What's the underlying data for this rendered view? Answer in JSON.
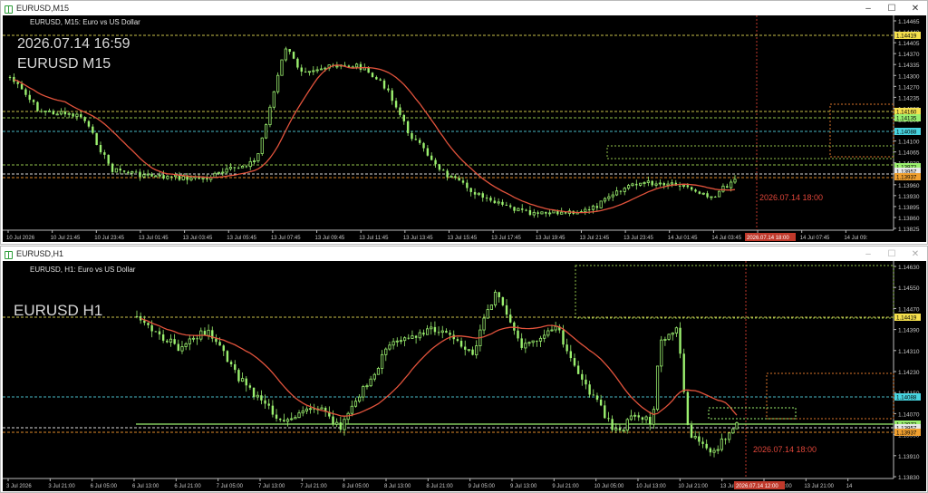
{
  "colors": {
    "background": "#000000",
    "bull": "#9bf06f",
    "bear": "#9bf06f",
    "ma": "#e2533c",
    "grid_text": "#c8c8c8",
    "vline": "#c0392b"
  },
  "windows": [
    {
      "title": "EURUSD,M15",
      "controls": [
        "–",
        "☐",
        "✕"
      ],
      "symbol_header": "EURUSD, M15: Euro vs US Dollar",
      "overlay_time": "2026.07.14 16:59",
      "overlay_symbol": "EURUSD M15",
      "future_label": "2026.07.14 18:00",
      "price_axis": [
        "1.14465",
        "1.14440",
        "1.14405",
        "1.14370",
        "1.14335",
        "1.14300",
        "1.14270",
        "1.14235",
        "1.14200",
        "1.14165",
        "1.14135",
        "1.14100",
        "1.14065",
        "1.14030",
        "1.13995",
        "1.13960",
        "1.13930",
        "1.13895",
        "1.13860",
        "1.13825"
      ],
      "price_tags": [
        {
          "text": "1.14419",
          "color": "#f5e04d"
        },
        {
          "text": "1.14160",
          "color": "#f5e04d"
        },
        {
          "text": "1.14135",
          "color": "#9bf06f"
        },
        {
          "text": "1.14088",
          "color": "#47d4e0"
        },
        {
          "text": "1.13972",
          "color": "#9bf06f"
        },
        {
          "text": "1.13957",
          "color": "#e8e8e8"
        },
        {
          "text": "1.13937",
          "color": "#f0a030"
        }
      ],
      "time_axis": [
        "10 Jul 2026",
        "10 Jul 21:45",
        "10 Jul 23:45",
        "13 Jul 01:45",
        "13 Jul 03:45",
        "13 Jul 05:45",
        "13 Jul 07:45",
        "13 Jul 09:45",
        "13 Jul 11:45",
        "13 Jul 13:45",
        "13 Jul 15:45",
        "13 Jul 17:45",
        "13 Jul 19:45",
        "13 Jul 21:45",
        "13 Jul 23:45",
        "14 Jul 01:45",
        "14 Jul 03:45",
        "14 Jul 05:45",
        "14 Jul 07:45",
        "14 Jul 09:"
      ],
      "time_tag": "2026.07.14 18:00"
    },
    {
      "title": "EURUSD,H1",
      "controls": [
        "–",
        "☐",
        "✕"
      ],
      "symbol_header": "EURUSD, H1: Euro vs US Dollar",
      "overlay_symbol": "EURUSD H1",
      "future_label": "2026.07.14 18:00",
      "price_axis": [
        "1.14630",
        "1.14550",
        "1.14470",
        "1.14390",
        "1.14310",
        "1.14230",
        "1.14150",
        "1.14070",
        "1.13990",
        "1.13910",
        "1.13830"
      ],
      "price_tags": [
        {
          "text": "1.14419",
          "color": "#f5e04d"
        },
        {
          "text": "1.14088",
          "color": "#47d4e0"
        },
        {
          "text": "1.13972",
          "color": "#9bf06f"
        },
        {
          "text": "1.13957",
          "color": "#e8e8e8"
        },
        {
          "text": "1.13937",
          "color": "#f0a030"
        }
      ],
      "time_axis": [
        "3 Jul 2026",
        "3 Jul 21:00",
        "6 Jul 05:00",
        "6 Jul 13:00",
        "6 Jul 21:00",
        "7 Jul 05:00",
        "7 Jul 13:00",
        "7 Jul 21:00",
        "8 Jul 05:00",
        "8 Jul 13:00",
        "8 Jul 21:00",
        "9 Jul 05:00",
        "9 Jul 13:00",
        "9 Jul 21:00",
        "10 Jul 05:00",
        "10 Jul 13:00",
        "10 Jul 21:00",
        "13 Jul 05:00",
        "13 Jul 13:00",
        "13 Jul 21:00",
        "14"
      ],
      "time_tag": "2026.07.14 12:00"
    }
  ]
}
